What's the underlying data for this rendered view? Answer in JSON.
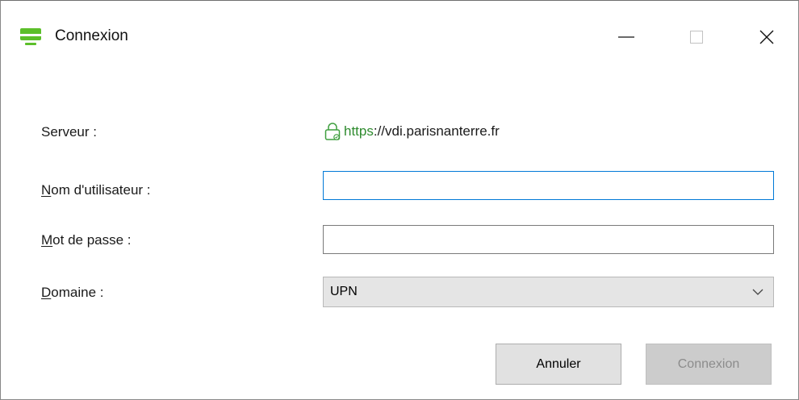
{
  "window": {
    "title": "Connexion",
    "icon": "monitor-icon",
    "controls": {
      "minimize": "minimize-icon",
      "maximize": "maximize-icon",
      "close": "close-icon"
    }
  },
  "form": {
    "server": {
      "label": "Serveur :",
      "icon": "lock-icon",
      "url_scheme": "https",
      "url_rest": "://vdi.parisnanterre.fr"
    },
    "username": {
      "label_mnemonic": "N",
      "label_rest": "om d'utilisateur :",
      "value": "",
      "placeholder": ""
    },
    "password": {
      "label_mnemonic": "M",
      "label_rest": "ot de passe :",
      "value": "",
      "placeholder": ""
    },
    "domain": {
      "label_mnemonic": "D",
      "label_rest": "omaine :",
      "selected": "UPN"
    }
  },
  "buttons": {
    "cancel": "Annuler",
    "connect": "Connexion"
  },
  "colors": {
    "accent": "#0078d7",
    "https_green": "#2e8b2e",
    "app_icon_green": "#5cbf2a"
  }
}
